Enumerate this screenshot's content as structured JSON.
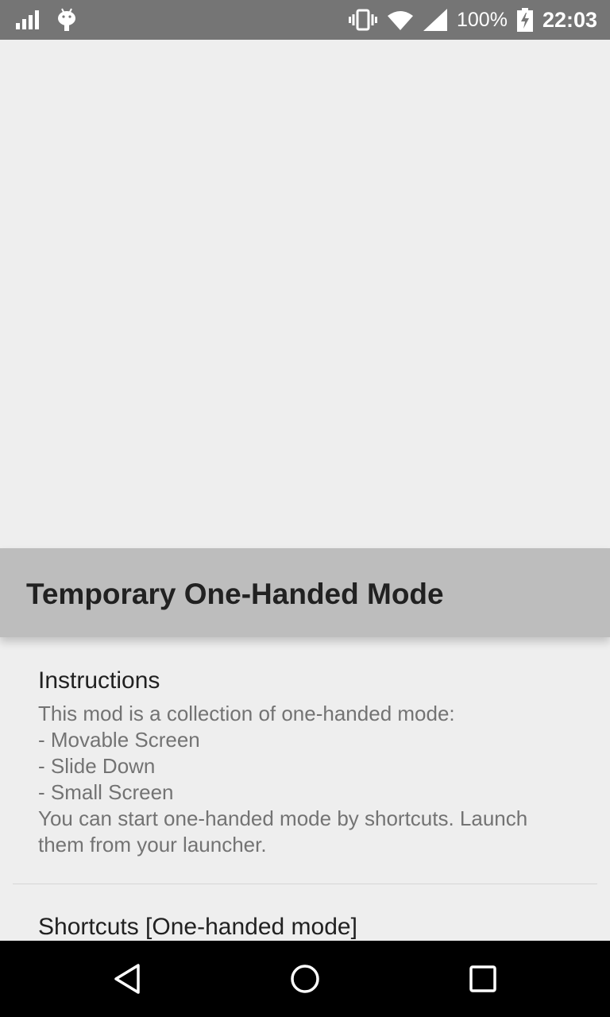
{
  "status_bar": {
    "battery_percent": "100%",
    "time": "22:03",
    "icons": [
      "signal-icon",
      "android-debug-icon",
      "vibrate-icon",
      "wifi-icon",
      "cell-signal-icon",
      "battery-charging-icon"
    ]
  },
  "dialog": {
    "title": "Temporary One-Handed Mode",
    "items": [
      {
        "title": "Instructions",
        "summary_lines": [
          "This mod is a collection of one-handed mode:",
          "- Movable Screen",
          "- Slide Down",
          "- Small Screen",
          "You can start one-handed mode by shortcuts. Launch",
          "them from your launcher."
        ]
      },
      {
        "title": "Shortcuts [One-handed mode]"
      }
    ]
  },
  "nav_bar": {
    "buttons": [
      "back-icon",
      "home-icon",
      "recents-icon"
    ]
  },
  "colors": {
    "status_bar": "#757575",
    "dialog_header": "#bdbdbd",
    "background": "#eeeeee",
    "nav_bar": "#000000"
  }
}
